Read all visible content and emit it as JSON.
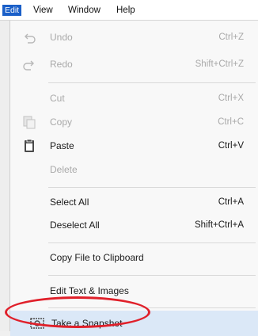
{
  "menubar": {
    "items": [
      {
        "label": "Edit"
      },
      {
        "label": "View"
      },
      {
        "label": "Window"
      },
      {
        "label": "Help"
      }
    ]
  },
  "menu": {
    "undo": {
      "label": "Undo",
      "shortcut": "Ctrl+Z"
    },
    "redo": {
      "label": "Redo",
      "shortcut": "Shift+Ctrl+Z"
    },
    "cut": {
      "label": "Cut",
      "shortcut": "Ctrl+X"
    },
    "copy": {
      "label": "Copy",
      "shortcut": "Ctrl+C"
    },
    "paste": {
      "label": "Paste",
      "shortcut": "Ctrl+V"
    },
    "delete": {
      "label": "Delete"
    },
    "select_all": {
      "label": "Select All",
      "shortcut": "Ctrl+A"
    },
    "deselect_all": {
      "label": "Deselect All",
      "shortcut": "Shift+Ctrl+A"
    },
    "copy_file": {
      "label": "Copy File to Clipboard"
    },
    "edit_text": {
      "label": "Edit Text & Images"
    },
    "snapshot": {
      "label": "Take a Snapshot"
    }
  },
  "colors": {
    "accent": "#1a5fc8",
    "highlight": "#dbe8f7",
    "circle": "#e0202a",
    "disabled_text": "#a9a9a9"
  }
}
